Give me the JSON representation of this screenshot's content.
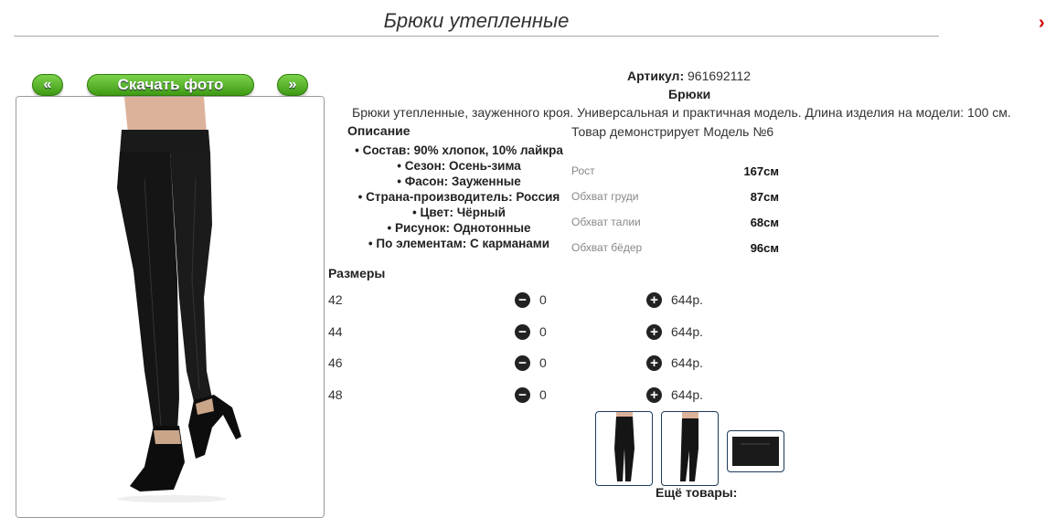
{
  "product": {
    "title": "Брюки утепленные",
    "article_label": "Артикул:",
    "article_value": "961692112",
    "type": "Брюки",
    "description": "Брюки утепленные, зауженного кроя. Универсальная и практичная модель. Длина изделия на модели: 100 см."
  },
  "gallery": {
    "prev_label": "«",
    "download_label": "Скачать фото",
    "next_label": "»"
  },
  "description_section": {
    "title": "Описание",
    "properties": [
      "Состав: 90% хлопок, 10% лайкра",
      "Сезон: Осень-зима",
      "Фасон: Зауженные",
      "Страна-производитель: Россия",
      "Цвет: Чёрный",
      "Рисунок: Однотонные",
      "По элементам: С карманами"
    ]
  },
  "model": {
    "note": "Товар демонстрирует Модель №6",
    "measurements": [
      {
        "label": "Рост",
        "value": "167см"
      },
      {
        "label": "Обхват груди",
        "value": "87см"
      },
      {
        "label": "Обхват талии",
        "value": "68см"
      },
      {
        "label": "Обхват бёдер",
        "value": "96см"
      }
    ]
  },
  "sizes": {
    "title": "Размеры",
    "rows": [
      {
        "size": "42",
        "qty": "0",
        "price": "644р."
      },
      {
        "size": "44",
        "qty": "0",
        "price": "644р."
      },
      {
        "size": "46",
        "qty": "0",
        "price": "644р."
      },
      {
        "size": "48",
        "qty": "0",
        "price": "644р."
      }
    ]
  },
  "more_goods_label": "Ещё товары:",
  "icons": {
    "minus": "minus-circle-icon",
    "plus": "plus-circle-icon"
  },
  "colors": {
    "accent_green": "#4caf1f",
    "thumb_border": "#1e3b5a"
  }
}
